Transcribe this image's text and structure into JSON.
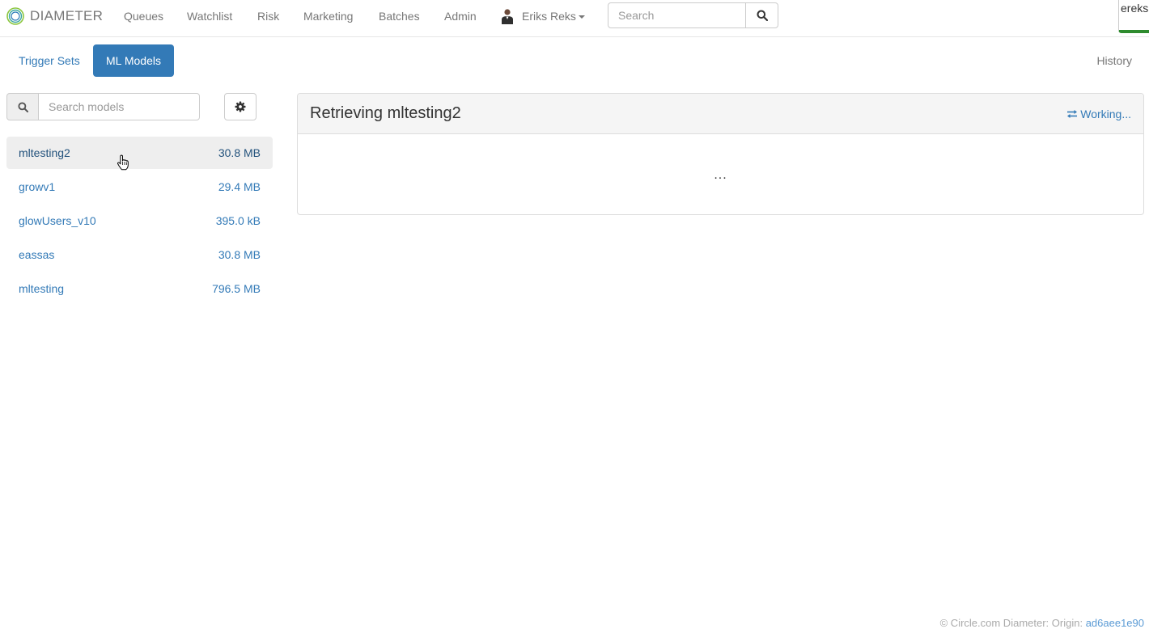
{
  "brand": {
    "name": "DIAMETER"
  },
  "nav": {
    "items": [
      {
        "label": "Queues"
      },
      {
        "label": "Watchlist"
      },
      {
        "label": "Risk"
      },
      {
        "label": "Marketing"
      },
      {
        "label": "Batches"
      },
      {
        "label": "Admin"
      }
    ],
    "user_name": "Eriks Reks",
    "search_placeholder": "Search",
    "user_tag": "ereks@"
  },
  "subtabs": {
    "trigger_sets": "Trigger Sets",
    "ml_models": "ML Models",
    "history": "History"
  },
  "sidebar": {
    "search_placeholder": "Search models",
    "models": [
      {
        "name": "mltesting2",
        "size": "30.8 MB",
        "selected": true
      },
      {
        "name": "growv1",
        "size": "29.4 MB"
      },
      {
        "name": "glowUsers_v10",
        "size": "395.0 kB"
      },
      {
        "name": "eassas",
        "size": "30.8 MB"
      },
      {
        "name": "mltesting",
        "size": "796.5 MB"
      }
    ]
  },
  "panel": {
    "title": "Retrieving mltesting2",
    "status": "Working...",
    "body": "..."
  },
  "footer": {
    "text": "© Circle.com   Diameter: Origin:",
    "commit": "ad6aee1e90"
  },
  "colors": {
    "primary": "#337ab7",
    "muted": "#777777",
    "user_tag_border": "#2e8b2e"
  },
  "icons": {
    "brand": "diameter-logo-icon",
    "nav_search": "search-icon",
    "model_search": "search-icon",
    "settings": "gear-icon",
    "status": "exchange-icon",
    "user": "avatar-icon"
  }
}
